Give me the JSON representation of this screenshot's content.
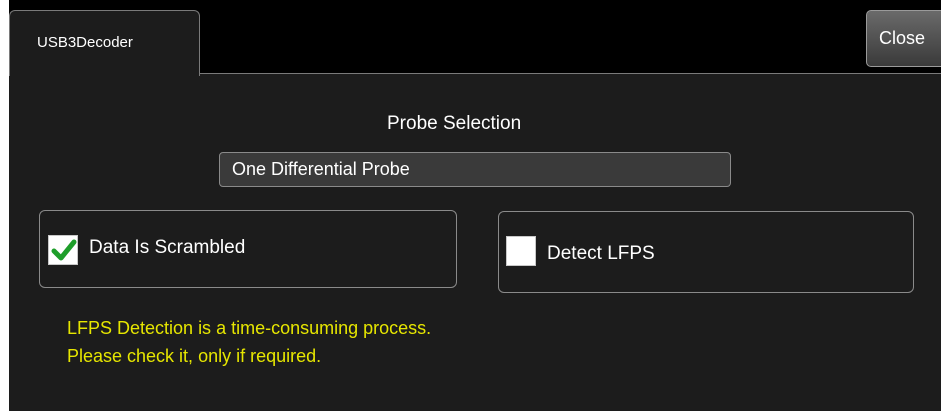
{
  "tab": {
    "label": "USB3Decoder"
  },
  "close_button": {
    "label": "Close"
  },
  "probe": {
    "title": "Probe Selection",
    "selected": "One Differential Probe"
  },
  "options": {
    "data_scrambled": {
      "label": "Data Is Scrambled",
      "checked": true
    },
    "detect_lfps": {
      "label": "Detect LFPS",
      "checked": false
    }
  },
  "warning": {
    "line1": "LFPS Detection is a time-consuming process.",
    "line2": "Please check it, only if required."
  },
  "colors": {
    "background": "#000000",
    "panel": "#1c1c1c",
    "warning_text": "#e6e600",
    "check_green": "#1e9e2a"
  },
  "icons": {
    "check": "checkmark-icon"
  }
}
